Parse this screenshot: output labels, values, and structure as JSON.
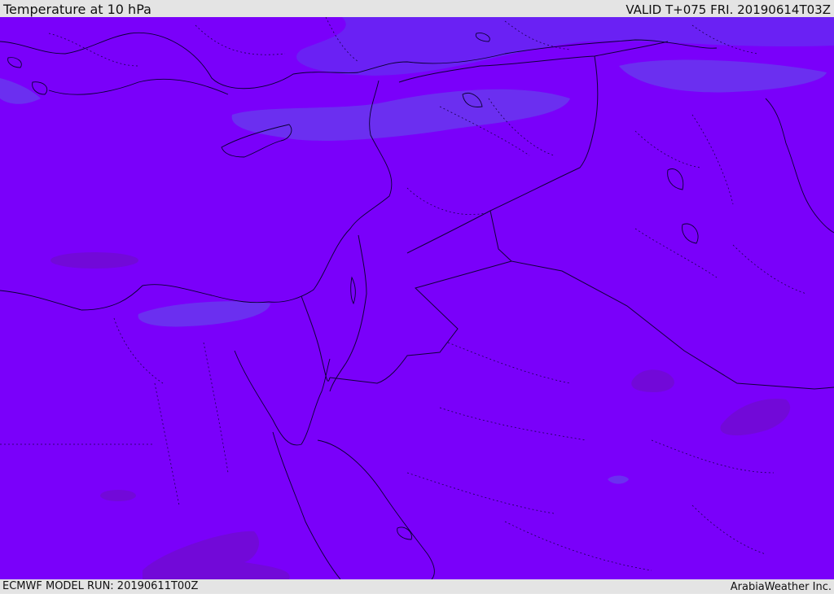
{
  "header": {
    "title": "Temperature at 10 hPa",
    "valid": "VALID T+075 FRI. 20190614T03Z"
  },
  "footer": {
    "model_run": "ECMWF MODEL RUN: 20190611T00Z",
    "credit": "ArabiaWeather Inc."
  },
  "map": {
    "field": "Temperature at 10 hPa",
    "colors": {
      "base": "#7a00fa",
      "colder_patch": "#6a21f4",
      "cold_patch": "#6b2ff0",
      "warm_patch": "#7209d8",
      "coast": "#0a0033",
      "border": "#12003a"
    }
  }
}
